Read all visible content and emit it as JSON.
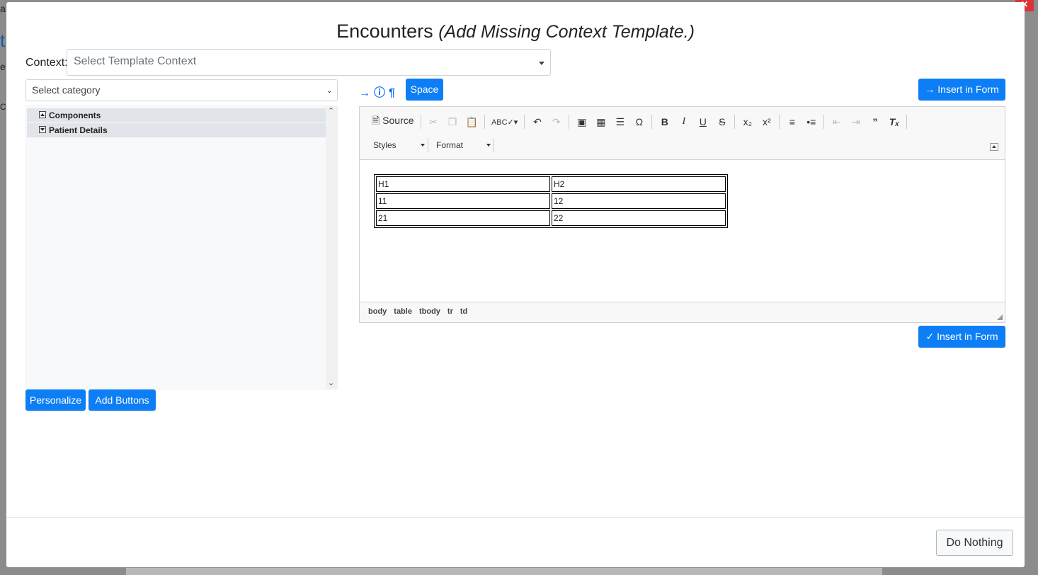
{
  "background": {
    "fragment_1": "al",
    "fragment_2": "t",
    "fragment_3": "e",
    "fragment_4": "Ce"
  },
  "modal": {
    "close_label": "×",
    "title_main": "Encounters",
    "title_sub": "(Add Missing Context Template.)",
    "context_label": "Context:",
    "context_placeholder": "Select Template Context",
    "category_placeholder": "Select category",
    "tree": [
      {
        "label": "Components",
        "state": "expanded"
      },
      {
        "label": "Patient Details",
        "state": "collapsed"
      }
    ],
    "personalize_label": "Personalize",
    "add_buttons_label": "Add Buttons",
    "space_label": "Space",
    "insert_top_label": "Insert in Form",
    "insert_bottom_label": "Insert in Form",
    "do_nothing_label": "Do Nothing"
  },
  "editor": {
    "source_label": "Source",
    "styles_label": "Styles",
    "format_label": "Format",
    "table": [
      [
        "H1",
        "H2"
      ],
      [
        "11",
        "12"
      ],
      [
        "21",
        "22"
      ]
    ],
    "path": [
      "body",
      "table",
      "tbody",
      "tr",
      "td"
    ]
  },
  "colors": {
    "primary": "#0d7ef5",
    "danger": "#d9343a"
  },
  "icons": {
    "signin": "sign-in-icon",
    "help": "question-circle-icon",
    "paragraph": "paragraph-icon"
  }
}
